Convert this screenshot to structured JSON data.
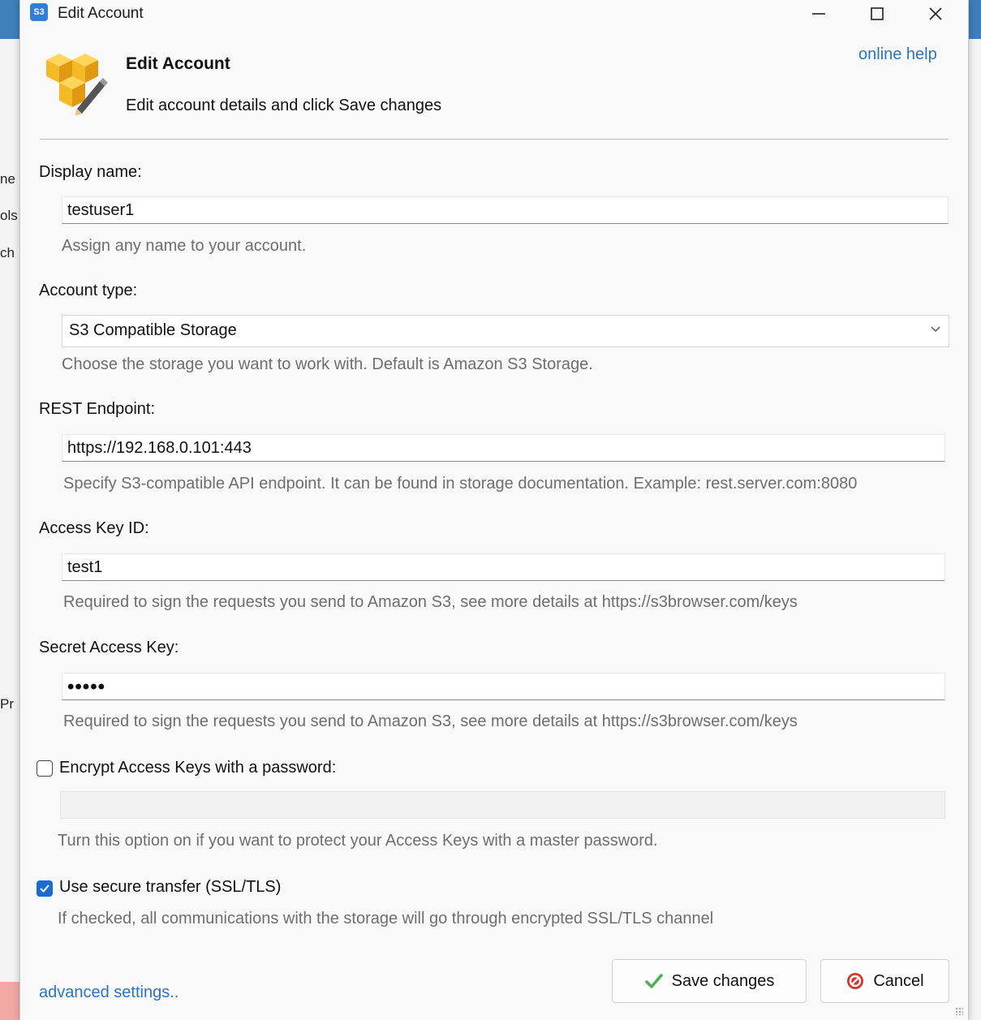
{
  "background": {
    "left_fragments": [
      "ne",
      "ols",
      "ch",
      "Pr"
    ]
  },
  "window": {
    "title": "Edit Account",
    "app_icon": "S3",
    "controls": [
      "minimize",
      "maximize",
      "close"
    ]
  },
  "header": {
    "title": "Edit Account",
    "subtitle": "Edit account details and click Save changes",
    "online_help": "online help",
    "icon": "boxes-edit-icon"
  },
  "form": {
    "display_name": {
      "label": "Display name:",
      "value": "testuser1",
      "hint": "Assign any name to your account."
    },
    "account_type": {
      "label": "Account type:",
      "value": "S3 Compatible Storage",
      "hint": "Choose the storage you want to work with. Default is Amazon S3 Storage."
    },
    "rest_endpoint": {
      "label": "REST Endpoint:",
      "value": "https://192.168.0.101:443",
      "hint": "Specify S3-compatible API endpoint. It can be found in storage documentation. Example: rest.server.com:8080"
    },
    "access_key_id": {
      "label": "Access Key ID:",
      "value": "test1",
      "hint": "Required to sign the requests you send to Amazon S3, see more details at https://s3browser.com/keys"
    },
    "secret_access_key": {
      "label": "Secret Access Key:",
      "value": "•••••",
      "hint": "Required to sign the requests you send to Amazon S3, see more details at https://s3browser.com/keys"
    },
    "encrypt_keys": {
      "label": "Encrypt Access Keys with a password:",
      "checked": false,
      "password_value": "",
      "hint": "Turn this option on if you want to protect your Access Keys with a master password."
    },
    "secure_transfer": {
      "label": "Use secure transfer (SSL/TLS)",
      "checked": true,
      "hint": "If checked, all communications with the storage will go through encrypted SSL/TLS channel"
    }
  },
  "footer": {
    "advanced_link": "advanced settings..",
    "save_label": "Save changes",
    "cancel_label": "Cancel"
  },
  "colors": {
    "link": "#2a73c7",
    "checkbox_checked": "#1a6ccf",
    "icon_gold": "#f5b928",
    "cancel_red": "#d9342b",
    "save_green": "#4caf50"
  }
}
